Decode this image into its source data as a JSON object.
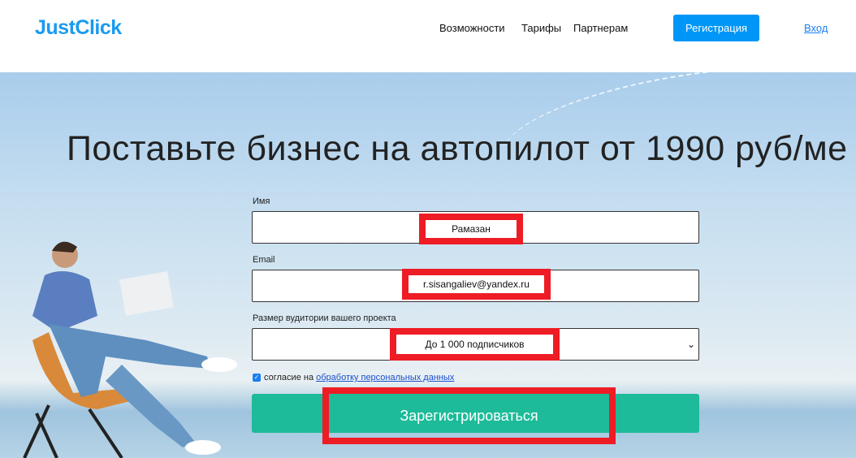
{
  "header": {
    "logo": "JustClick",
    "nav": [
      "Возможности",
      "Тарифы",
      "Партнерам"
    ],
    "register": "Регистрация",
    "login": "Вход",
    "accent": "#0096f7"
  },
  "hero": {
    "title": "Поставьте бизнес на автопилот от 1990 руб/ме"
  },
  "form": {
    "name_label": "Имя",
    "name_value": "Рамазан",
    "email_label": "Email",
    "email_value": "r.sisangaliev@yandex.ru",
    "audience_label": "Размер вудитории вашего проекта",
    "audience_value": "До 1 000 подписчиков",
    "consent_text": "согласие на",
    "consent_link": "обработку персональных данных",
    "consent_checked": true,
    "submit": "Зарегистрироваться",
    "submit_color": "#1dbb99"
  }
}
